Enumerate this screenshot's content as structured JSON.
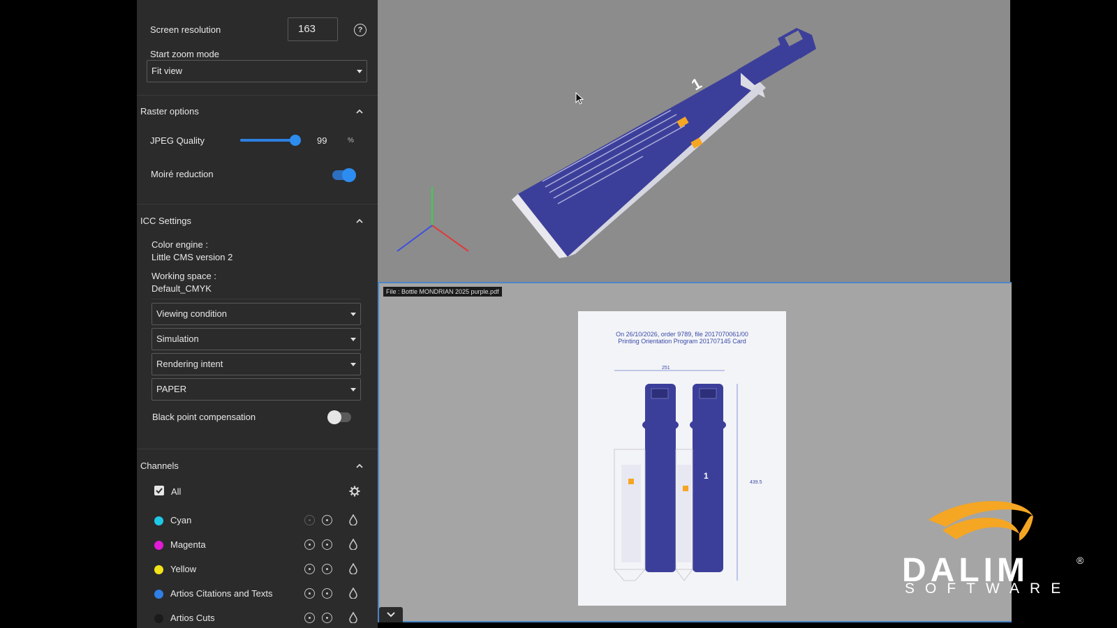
{
  "panel": {
    "screen_resolution": {
      "label": "Screen resolution",
      "value": "163",
      "help": "?"
    },
    "start_zoom": {
      "label": "Start zoom mode",
      "value": "Fit view"
    },
    "raster": {
      "title": "Raster options",
      "jpeg": {
        "label": "JPEG Quality",
        "value": "99",
        "unit": "%",
        "fraction": 0.99
      },
      "moire": {
        "label": "Moiré reduction",
        "on": true
      }
    },
    "icc": {
      "title": "ICC Settings",
      "engine_label": "Color engine :",
      "engine_value": "Little CMS version 2",
      "workspace_label": "Working space :",
      "workspace_value": "Default_CMYK",
      "viewing": "Viewing condition",
      "simulation": "Simulation",
      "intent": "Rendering intent",
      "paper": "PAPER",
      "bpc": {
        "label": "Black point compensation",
        "on": false
      }
    },
    "channels": {
      "title": "Channels",
      "all_label": "All",
      "items": [
        {
          "name": "Cyan",
          "color": "#1ec8e6"
        },
        {
          "name": "Magenta",
          "color": "#e21ad6"
        },
        {
          "name": "Yellow",
          "color": "#f2e21a"
        },
        {
          "name": "Artios Citations and Texts",
          "color": "#2f7fe6"
        },
        {
          "name": "Artios Cuts",
          "color": "#1b1b1b"
        }
      ]
    }
  },
  "viewer": {
    "file_label": "File : Bottle MONDRIAN 2025 purple.pdf",
    "pdf_header_line1": "On 26/10/2026, order 9789, file 2017070061/00",
    "pdf_header_line2": "Printing Orientation Program 201707145 Card",
    "dim_width": "251",
    "dim_height": "439.5"
  },
  "logo": {
    "name": "DALIM",
    "sub": "SOFTWARE",
    "reg": "®"
  },
  "colors": {
    "accent": "#2d8cf0",
    "panel_bg": "#2b2b2b",
    "brand_orange": "#f5a623",
    "box_purple": "#3c3f9a"
  }
}
